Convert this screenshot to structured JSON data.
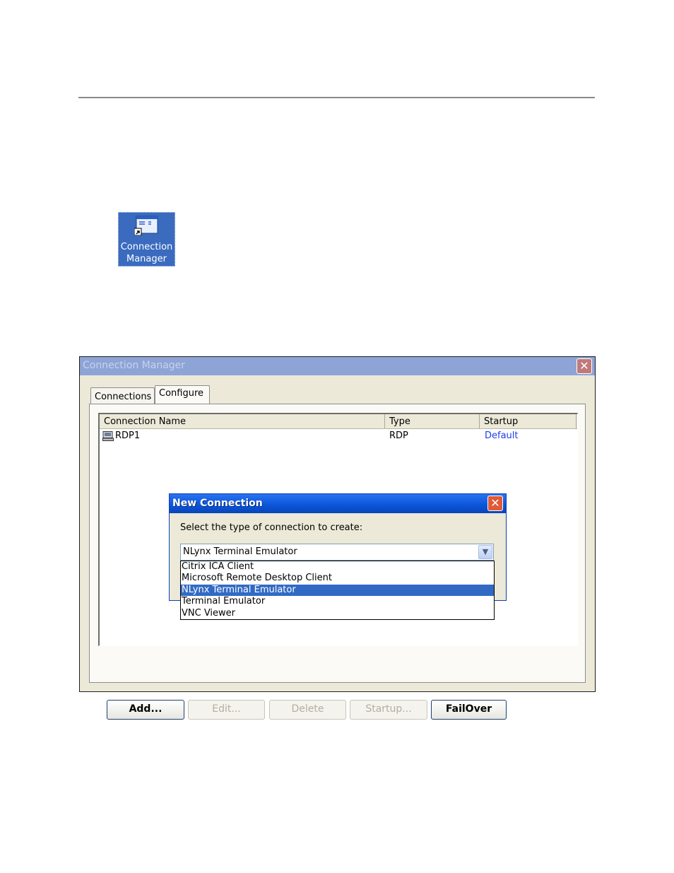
{
  "desktop": {
    "shortcut_label_line1": "Connection",
    "shortcut_label_line2": "Manager",
    "shortcut_icon": "connection-manager-icon"
  },
  "window": {
    "title": "Connection Manager",
    "close_glyph": "✕",
    "tabs": [
      {
        "label": "Connections",
        "active": false
      },
      {
        "label": "Configure",
        "active": true
      }
    ],
    "list": {
      "columns": [
        "Connection Name",
        "Type",
        "Startup"
      ],
      "rows": [
        {
          "name": "RDP1",
          "type": "RDP",
          "startup": "Default",
          "icon": "computer-icon"
        }
      ]
    },
    "buttons": [
      {
        "label": "Add...",
        "enabled": true
      },
      {
        "label": "Edit...",
        "enabled": false
      },
      {
        "label": "Delete",
        "enabled": false
      },
      {
        "label": "Startup...",
        "enabled": false
      },
      {
        "label": "FailOver",
        "enabled": true
      }
    ]
  },
  "dialog": {
    "title": "New Connection",
    "close_glyph": "✕",
    "prompt": "Select the type of connection to create:",
    "selected_value": "NLynx Terminal Emulator",
    "dropdown_arrow": "chevron-down-icon",
    "options": [
      "Citrix ICA Client",
      "Microsoft Remote Desktop Client",
      "NLynx Terminal Emulator",
      "Terminal Emulator",
      "VNC Viewer"
    ],
    "highlighted_index": 2
  },
  "colors": {
    "dialog_title_blue": "#0a54d8",
    "selection_blue": "#316ac5",
    "link_blue": "#1a3ef0",
    "window_face": "#ece9d8"
  }
}
